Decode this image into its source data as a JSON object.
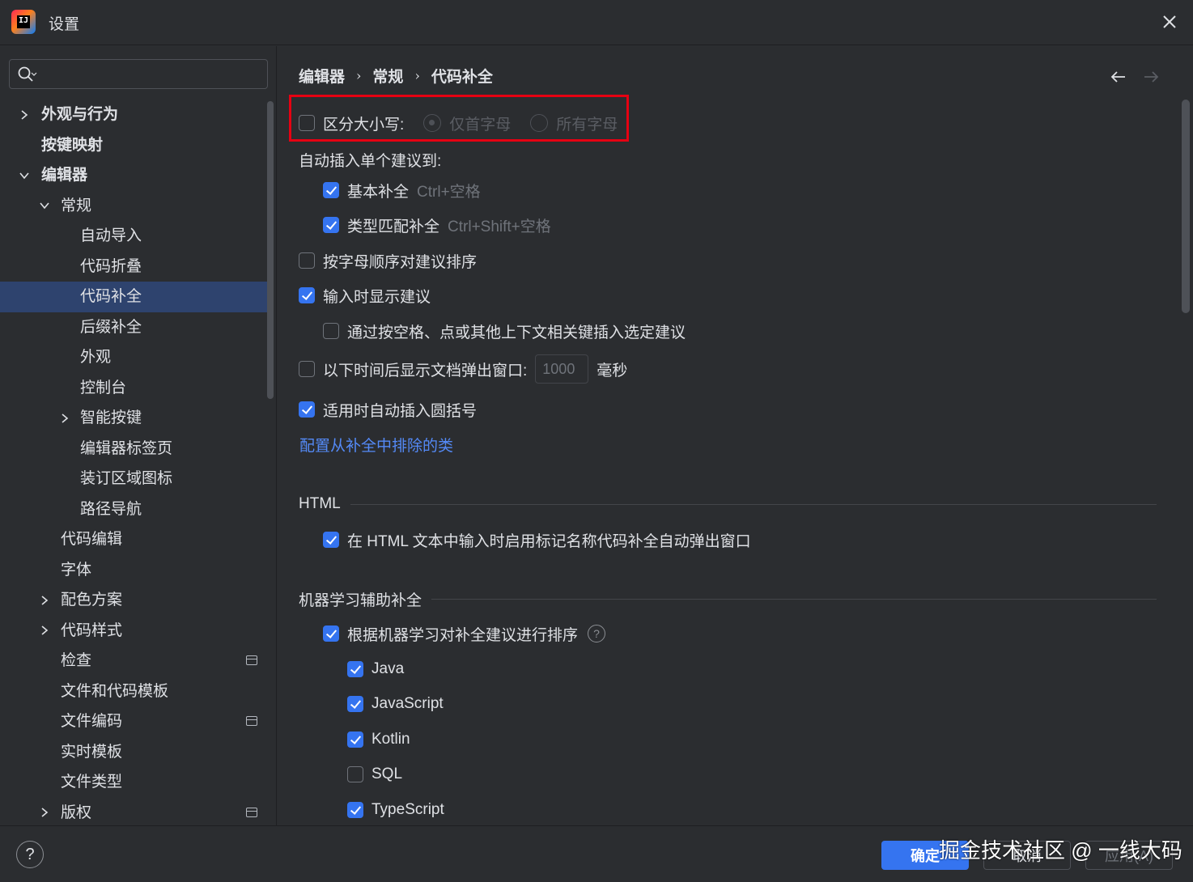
{
  "window": {
    "title": "设置",
    "logo_text": "IJ"
  },
  "search": {
    "placeholder": ""
  },
  "sidebar": {
    "items": [
      {
        "label": "外观与行为",
        "chevron": "right"
      },
      {
        "label": "按键映射"
      },
      {
        "label": "编辑器",
        "chevron": "down"
      },
      {
        "label": "常规",
        "chevron": "down"
      },
      {
        "label": "自动导入"
      },
      {
        "label": "代码折叠"
      },
      {
        "label": "代码补全",
        "selected": true
      },
      {
        "label": "后缀补全"
      },
      {
        "label": "外观"
      },
      {
        "label": "控制台"
      },
      {
        "label": "智能按键",
        "chevron": "right"
      },
      {
        "label": "编辑器标签页"
      },
      {
        "label": "装订区域图标"
      },
      {
        "label": "路径导航"
      },
      {
        "label": "代码编辑"
      },
      {
        "label": "字体"
      },
      {
        "label": "配色方案",
        "chevron": "right"
      },
      {
        "label": "代码样式",
        "chevron": "right"
      },
      {
        "label": "检查",
        "icon": "project-scope-icon"
      },
      {
        "label": "文件和代码模板"
      },
      {
        "label": "文件编码",
        "icon": "project-scope-icon"
      },
      {
        "label": "实时模板"
      },
      {
        "label": "文件类型"
      },
      {
        "label": "版权",
        "chevron": "right",
        "icon": "project-scope-icon"
      }
    ]
  },
  "breadcrumb": {
    "part1": "编辑器",
    "part2": "常规",
    "part3": "代码补全",
    "sep": "›"
  },
  "options": {
    "case_sensitive": {
      "label": "区分大小写:",
      "checked": false
    },
    "first_letter": {
      "label": "仅首字母",
      "selected": true
    },
    "all_letters": {
      "label": "所有字母",
      "selected": false
    },
    "auto_insert_heading": "自动插入单个建议到:",
    "basic_completion": {
      "label": "基本补全",
      "shortcut": "Ctrl+空格",
      "checked": true
    },
    "type_completion": {
      "label": "类型匹配补全",
      "shortcut": "Ctrl+Shift+空格",
      "checked": true
    },
    "sort_alpha": {
      "label": "按字母顺序对建议排序",
      "checked": false
    },
    "show_suggestions": {
      "label": "输入时显示建议",
      "checked": true
    },
    "insert_by_space": {
      "label": "通过按空格、点或其他上下文相关键插入选定建议",
      "checked": false
    },
    "doc_popup": {
      "label": "以下时间后显示文档弹出窗口:",
      "value": "1000",
      "unit": "毫秒",
      "checked": false
    },
    "auto_parens": {
      "label": "适用时自动插入圆括号",
      "checked": true
    },
    "exclude_link": "配置从补全中排除的类"
  },
  "html_section": {
    "title": "HTML",
    "tag_popup": {
      "label": "在 HTML 文本中输入时启用标记名称代码补全自动弹出窗口",
      "checked": true
    }
  },
  "ml_section": {
    "title": "机器学习辅助补全",
    "sort_ml": {
      "label": "根据机器学习对补全建议进行排序",
      "checked": true,
      "help": "?"
    },
    "languages": [
      {
        "label": "Java",
        "checked": true
      },
      {
        "label": "JavaScript",
        "checked": true
      },
      {
        "label": "Kotlin",
        "checked": true
      },
      {
        "label": "SQL",
        "checked": false
      },
      {
        "label": "TypeScript",
        "checked": true
      }
    ]
  },
  "footer": {
    "help": "?",
    "ok": "确定",
    "cancel": "取消",
    "apply": "应用(A)",
    "watermark": "掘金技术社区 @ 一线大码"
  },
  "colors": {
    "background": "#2b2d30",
    "accent": "#3574f0",
    "selected_row": "#2e436e",
    "link": "#548af7",
    "highlight_box": "#e60012"
  }
}
